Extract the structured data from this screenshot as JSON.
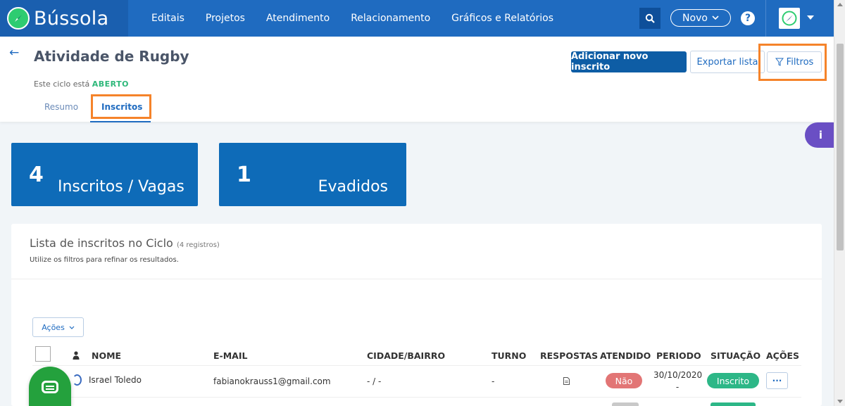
{
  "app": {
    "brand": "Bússola"
  },
  "nav": {
    "items": [
      "Editais",
      "Projetos",
      "Atendimento",
      "Relacionamento",
      "Gráficos e Relatórios"
    ],
    "novo_label": "Novo",
    "help_label": "?"
  },
  "header": {
    "title": "Atividade de Rugby",
    "cycle_prefix": "Este ciclo está",
    "cycle_status": "ABERTO",
    "tabs": [
      "Resumo",
      "Inscritos"
    ],
    "active_tab": "Inscritos",
    "btn_add": "Adicionar novo inscrito",
    "btn_export": "Exportar lista",
    "btn_filter": "Filtros"
  },
  "info_badge": "i",
  "stats": [
    {
      "value": "4",
      "label": "Inscritos / Vagas"
    },
    {
      "value": "1",
      "label": "Evadidos"
    }
  ],
  "list": {
    "title": "Lista de inscritos no Ciclo",
    "count_note": "(4 registros)",
    "subtitle": "Utilize os filtros para refinar os resultados.",
    "acoes_label": "Ações",
    "columns": [
      "NOME",
      "E-MAIL",
      "CIDADE/BAIRRO",
      "TURNO",
      "RESPOSTAS",
      "ATENDIDO",
      "PERIODO",
      "SITUAÇÃO",
      "AÇÕES"
    ],
    "rows": [
      {
        "nome": "Israel Toledo",
        "email": "fabianokrauss1@gmail.com",
        "cidade": "- / -",
        "turno": "-",
        "atendido": "Não",
        "periodo_date": "30/10/2020",
        "periodo_dash": "-",
        "situacao": "Inscrito",
        "acoes": "···"
      }
    ]
  },
  "colors": {
    "nav_bg": "#1f6bc0",
    "brand_bg": "#1a5faf",
    "primary": "#0e5da5",
    "stat_card": "#0e6bb8",
    "status_open": "#2eb87a",
    "badge_nao": "#e27575",
    "badge_inscrito": "#2db787",
    "highlight": "#f5832a",
    "info_badge": "#6a4fc4",
    "chat_fab": "#24a13d"
  },
  "icons": {
    "brand": "compass-icon",
    "search": "search-icon",
    "help": "help-icon",
    "user": "compass-avatar-icon",
    "back": "arrow-left-icon",
    "filter": "funnel-icon",
    "respostas": "document-icon",
    "chat": "chat-icon"
  }
}
